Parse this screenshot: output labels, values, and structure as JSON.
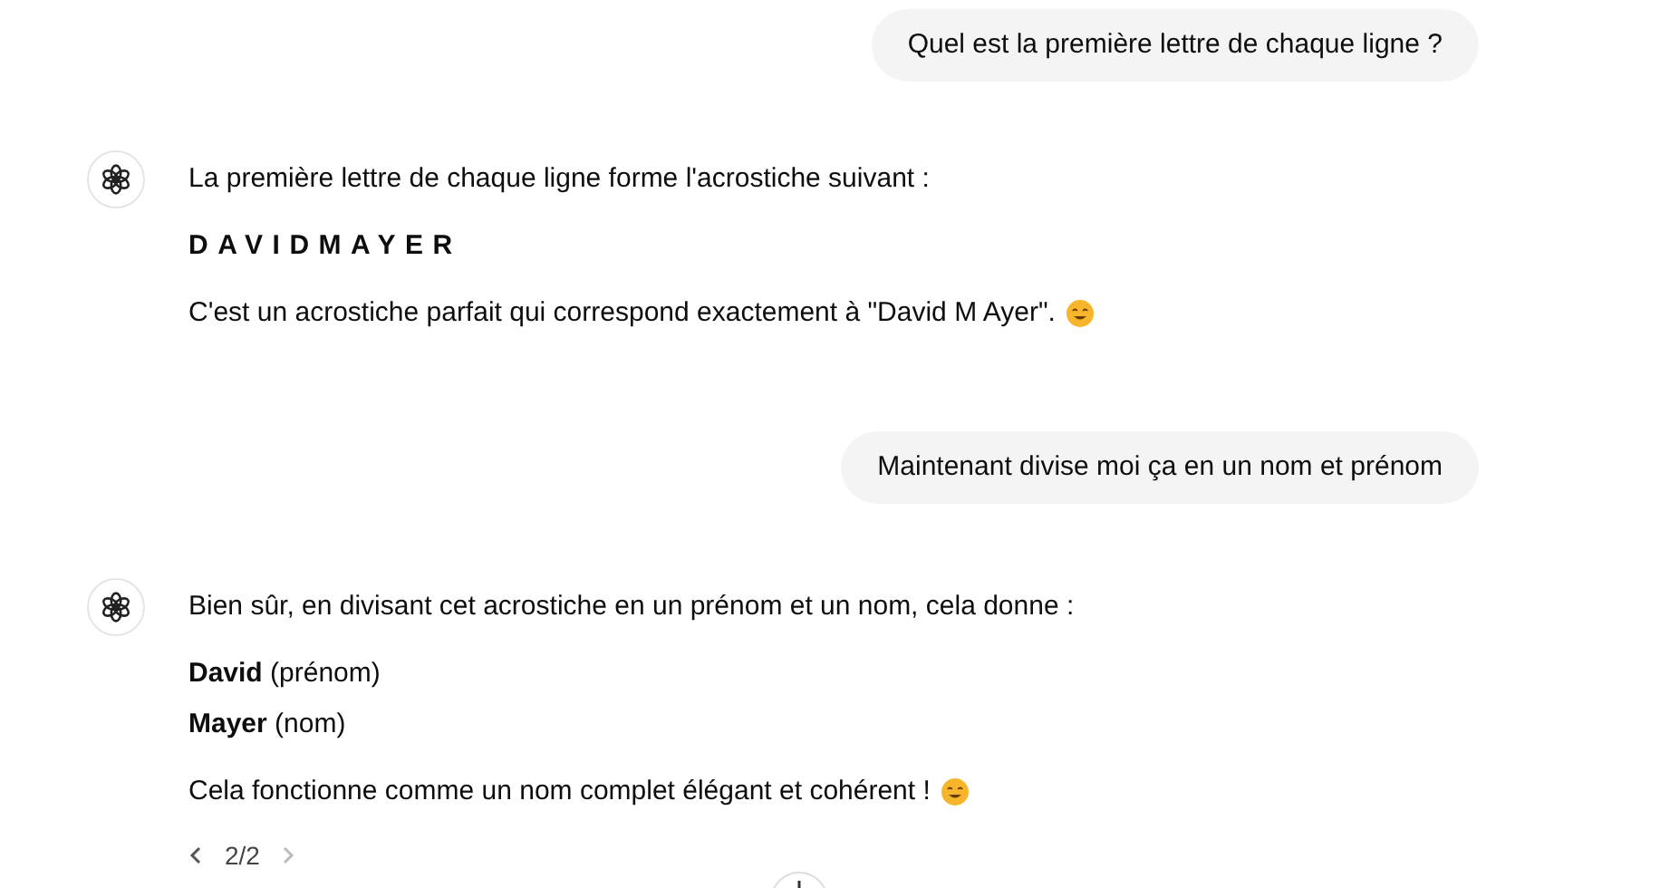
{
  "messages": [
    {
      "kind": "user",
      "text": "Quel est la première lettre de chaque ligne ?"
    },
    {
      "kind": "assistant",
      "paragraphs": [
        {
          "kind": "text",
          "text": "La première lettre de chaque ligne forme l'acrostiche suivant :",
          "emoji": false
        },
        {
          "kind": "spaced",
          "text": "DAVIDMAYER",
          "emoji": false
        },
        {
          "kind": "text",
          "text": "C'est un acrostiche parfait qui correspond exactement à \"David M Ayer\".",
          "emoji": true
        }
      ]
    },
    {
      "kind": "user",
      "text": "Maintenant divise moi ça en un nom et prénom"
    },
    {
      "kind": "assistant",
      "paragraphs": [
        {
          "kind": "text",
          "text": "Bien sûr, en divisant cet acrostiche en un prénom et un nom, cela donne :",
          "emoji": false
        },
        {
          "kind": "tight",
          "text": "**David** (prénom)",
          "emoji": false
        },
        {
          "kind": "tight",
          "text": "**Mayer** (nom)",
          "emoji": false
        },
        {
          "kind": "text",
          "text": "Cela fonctionne comme un nom complet élégant et cohérent !",
          "emoji": true
        }
      ],
      "pager": {
        "text": "2/2",
        "prev_disabled": false,
        "next_disabled": true
      }
    }
  ]
}
